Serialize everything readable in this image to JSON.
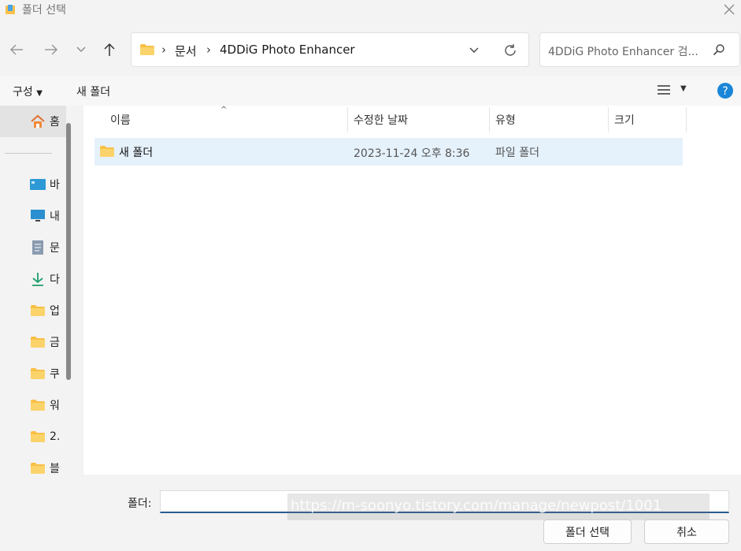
{
  "window": {
    "title": "폴더 선택"
  },
  "nav": {
    "breadcrumbs": [
      "문서",
      "4DDiG Photo Enhancer"
    ],
    "search_placeholder": "4DDiG Photo Enhancer 검..."
  },
  "toolbar": {
    "organize_label": "구성",
    "new_folder_label": "새 폴더"
  },
  "sidebar": {
    "items": [
      {
        "label": "홈",
        "icon": "home-icon"
      },
      {
        "label": "바",
        "icon": "desktop-icon"
      },
      {
        "label": "내",
        "icon": "pc-icon"
      },
      {
        "label": "문",
        "icon": "document-icon"
      },
      {
        "label": "다",
        "icon": "download-icon"
      },
      {
        "label": "업",
        "icon": "folder-icon"
      },
      {
        "label": "금",
        "icon": "folder-icon"
      },
      {
        "label": "쿠",
        "icon": "folder-icon"
      },
      {
        "label": "워",
        "icon": "folder-icon"
      },
      {
        "label": "2.",
        "icon": "folder-icon"
      },
      {
        "label": "블",
        "icon": "folder-icon"
      }
    ]
  },
  "columns": {
    "name": "이름",
    "modified": "수정한 날짜",
    "type": "유형",
    "size": "크기"
  },
  "files": [
    {
      "name": "새 폴더",
      "modified": "2023-11-24 오후 8:36",
      "type": "파일 폴더",
      "size": ""
    }
  ],
  "footer": {
    "folder_label": "폴더:",
    "folder_value": "",
    "watermark": "https://m-soonyo.tistory.com/manage/newpost/1001",
    "select_button": "폴더 선택",
    "cancel_button": "취소"
  },
  "colors": {
    "accent": "#0067c0",
    "selection": "#e5f1fb",
    "folder": "#f8c046",
    "help": "#1a86d8"
  }
}
